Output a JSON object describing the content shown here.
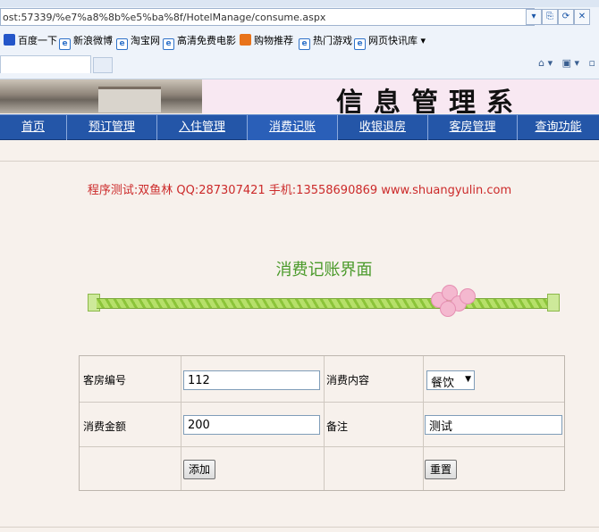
{
  "browser": {
    "url": "ost:57339/%e7%a8%8b%e5%ba%8f/HotelManage/consume.aspx",
    "favorites": [
      {
        "label": "百度一下",
        "icon": "baidu-icon"
      },
      {
        "label": "新浪微博",
        "icon": "ie-page-icon"
      },
      {
        "label": "淘宝网",
        "icon": "ie-page-icon"
      },
      {
        "label": "高清免费电影",
        "icon": "ie-page-icon"
      },
      {
        "label": "购物推荐",
        "icon": "dangdang-icon"
      },
      {
        "label": "热门游戏",
        "icon": "ie-page-icon"
      },
      {
        "label": "网页快讯库 ▾",
        "icon": "ie-page-icon"
      }
    ]
  },
  "banner": {
    "title": "信息管理系"
  },
  "nav": {
    "items": [
      "首页",
      "预订管理",
      "入住管理",
      "消费记账",
      "收银退房",
      "客房管理",
      "查询功能"
    ]
  },
  "page": {
    "credit": "程序测试:双鱼林 QQ:287307421 手机:13558690869 www.shuangyulin.com",
    "title": "消费记账界面"
  },
  "form": {
    "room_label": "客房编号",
    "room_value": "112",
    "content_label": "消费内容",
    "content_value": "餐饮",
    "amount_label": "消费金额",
    "amount_value": "200",
    "note_label": "备注",
    "note_value": "测试",
    "add_label": "添加",
    "reset_label": "重置"
  },
  "colors": {
    "nav_bg": "#2456a8",
    "credit": "#cc2a2a",
    "title": "#4a9a2a"
  }
}
